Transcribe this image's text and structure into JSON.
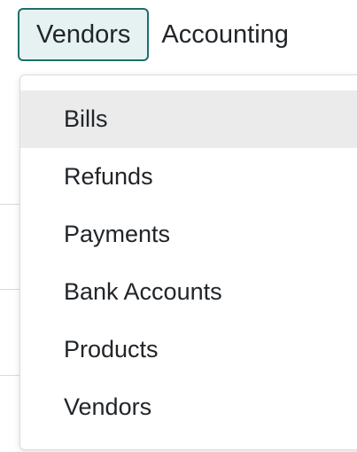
{
  "topnav": {
    "items": [
      {
        "label": "Vendors",
        "active": true
      },
      {
        "label": "Accounting",
        "active": false
      }
    ]
  },
  "dropdown": {
    "highlighted_index": 0,
    "items": [
      {
        "label": "Bills"
      },
      {
        "label": "Refunds"
      },
      {
        "label": "Payments"
      },
      {
        "label": "Bank Accounts"
      },
      {
        "label": "Products"
      },
      {
        "label": "Vendors"
      }
    ]
  },
  "colors": {
    "active_border": "#1d6f6e",
    "active_background": "#e6f2f2",
    "highlight_background": "#ebebeb",
    "text": "#212529"
  }
}
